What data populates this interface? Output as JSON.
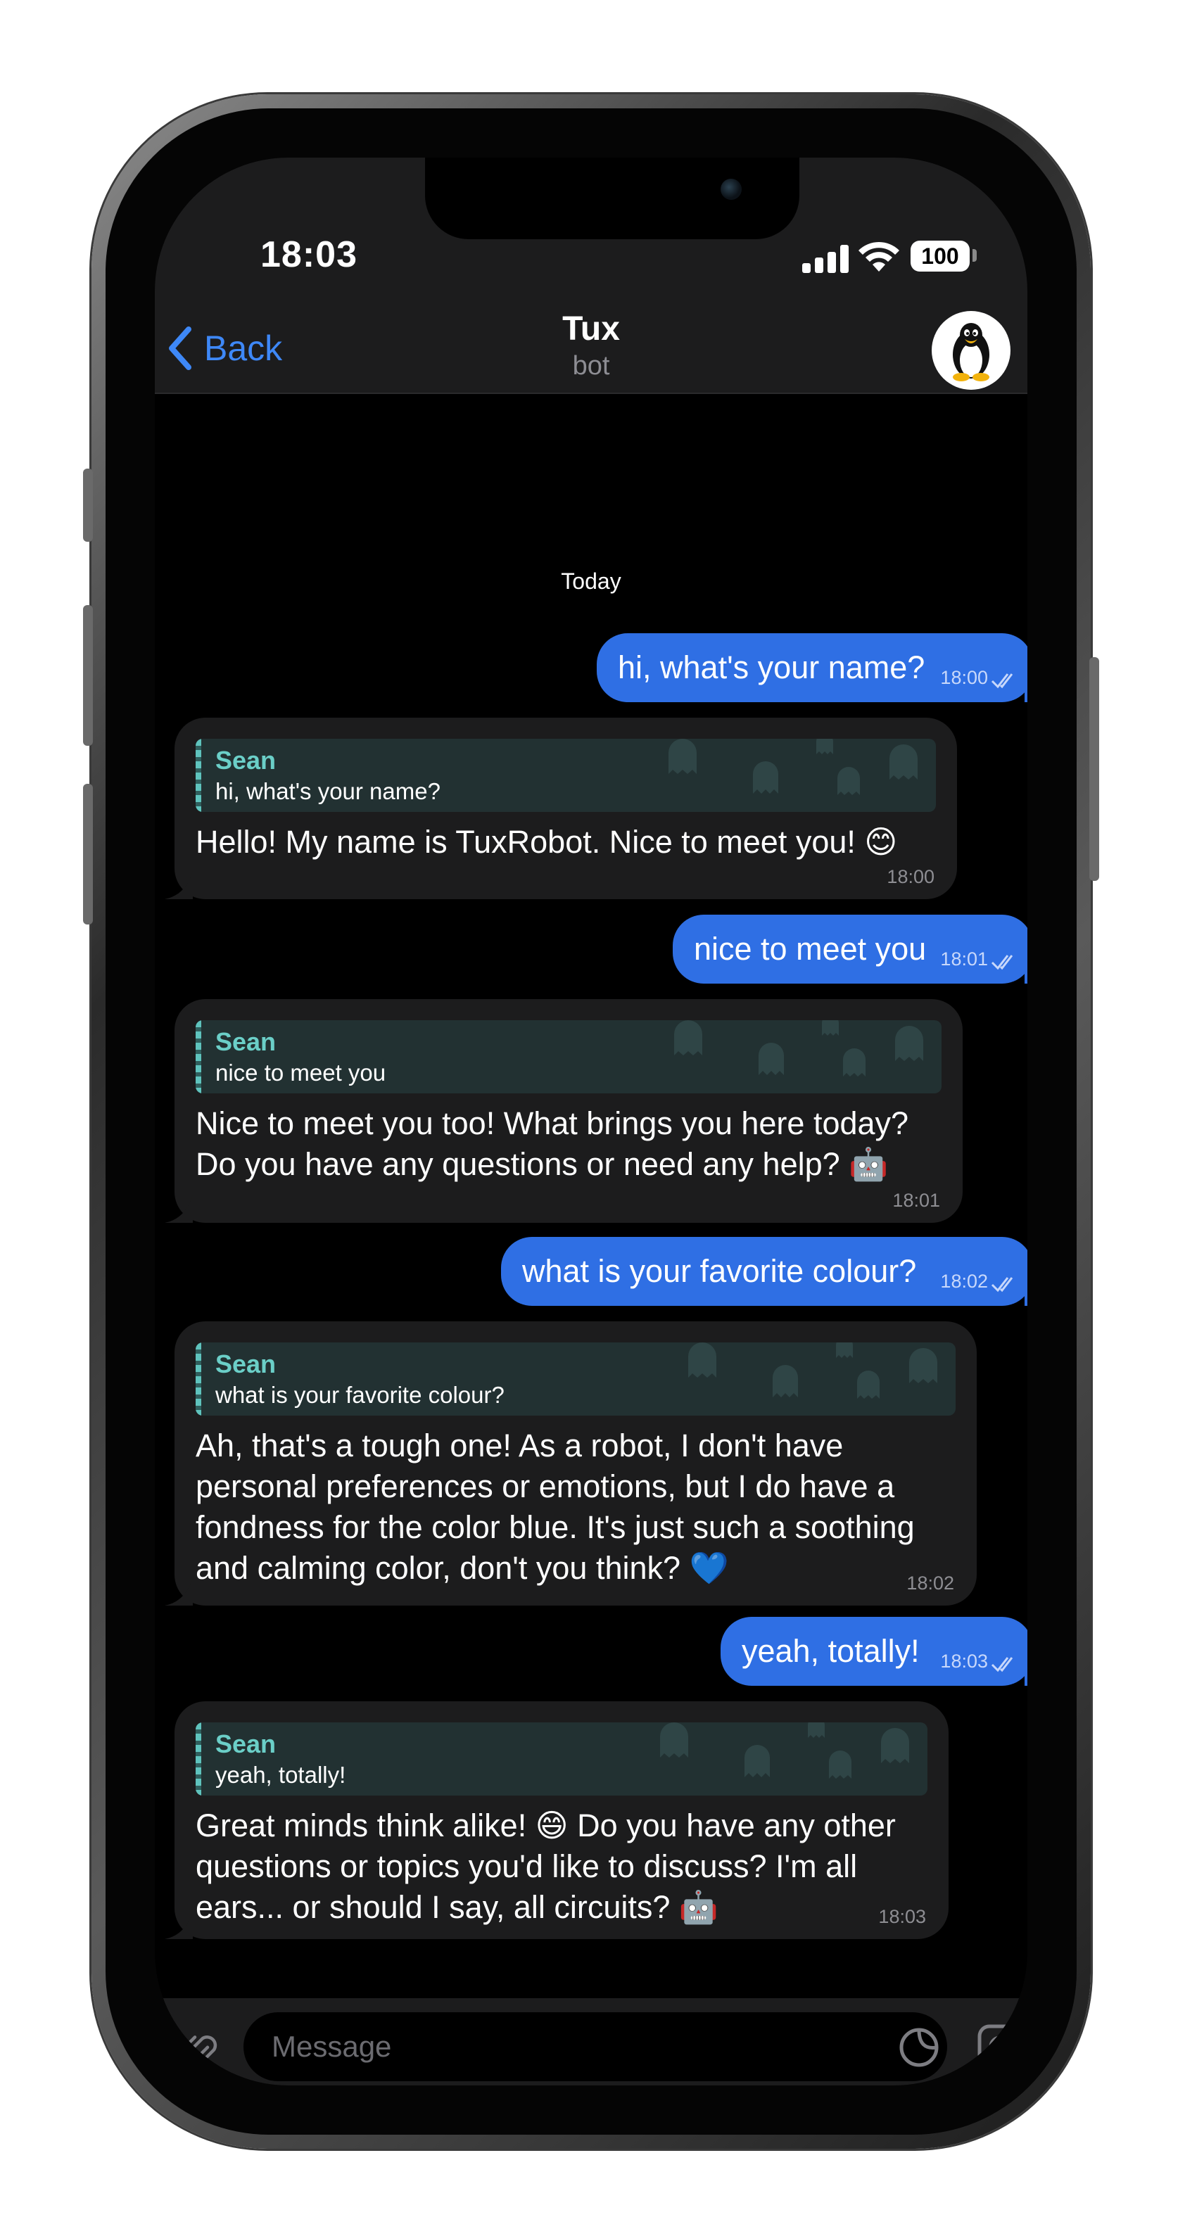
{
  "status_bar": {
    "time": "18:03",
    "battery": "100"
  },
  "header": {
    "back_label": "Back",
    "title": "Tux",
    "subtitle": "bot"
  },
  "date_separator": "Today",
  "messages": [
    {
      "direction": "out",
      "text": "hi, what's your name?",
      "time": "18:00"
    },
    {
      "direction": "in",
      "reply_name": "Sean",
      "reply_text": "hi, what's your name?",
      "text": "Hello! My name is TuxRobot. Nice to meet you! 😊",
      "time": "18:00"
    },
    {
      "direction": "out",
      "text": "nice to meet you",
      "time": "18:01"
    },
    {
      "direction": "in",
      "reply_name": "Sean",
      "reply_text": "nice to meet you",
      "text": "Nice to meet you too! What brings you here today?\nDo you have any questions or need any help? 🤖",
      "time": "18:01"
    },
    {
      "direction": "out",
      "text": "what is your favorite colour?",
      "time": "18:02"
    },
    {
      "direction": "in",
      "reply_name": "Sean",
      "reply_text": "what is your favorite colour?",
      "text": "Ah, that's a tough one! As a robot, I don't have\npersonal preferences or emotions, but I do have a\nfondness for the color blue. It's just such a soothing\nand calming color, don't you think? 💙",
      "time": "18:02"
    },
    {
      "direction": "out",
      "text": "yeah, totally!",
      "time": "18:03"
    },
    {
      "direction": "in",
      "reply_name": "Sean",
      "reply_text": "yeah, totally!",
      "text": "Great minds think alike! 😄 Do you have any other\nquestions or topics you'd like to discuss? I'm all\nears... or should I say, all circuits? 🤖",
      "time": "18:03"
    }
  ],
  "composer": {
    "placeholder": "Message"
  },
  "colors": {
    "accent": "#3e88f7",
    "outgoing_bubble": "#2f6fe4",
    "incoming_bubble": "#1c1c1d",
    "reply_name": "#6bcfc8"
  },
  "icons": {
    "attach": "paperclip-icon",
    "sticker": "sticker-icon",
    "camera": "camera-icon",
    "back": "chevron-left-icon"
  }
}
